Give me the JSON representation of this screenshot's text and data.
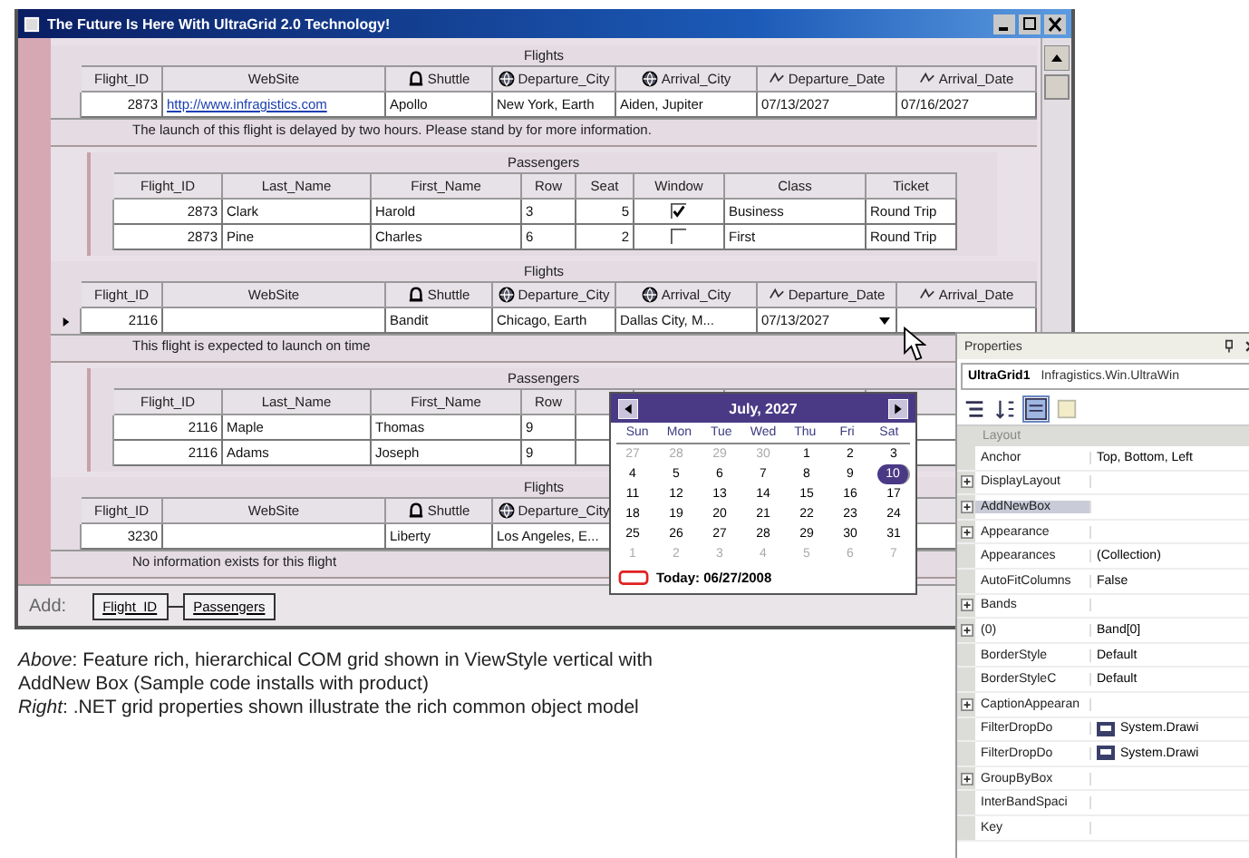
{
  "window": {
    "title": "The Future Is Here With UltraGrid 2.0 Technology!"
  },
  "flights": [
    {
      "caption": "Flights",
      "columns": [
        "Flight_ID",
        "WebSite",
        "Shuttle",
        "Departure_City",
        "Arrival_City",
        "Departure_Date",
        "Arrival_Date"
      ],
      "current": false,
      "cells": [
        "2873",
        "http://www.infragistics.com",
        "Apollo",
        "New York, Earth",
        "Aiden, Jupiter",
        "07/13/2027",
        "07/16/2027"
      ],
      "note": "The launch of this flight is delayed by two hours. Please stand by for more information.",
      "passengers": {
        "caption": "Passengers",
        "columns": [
          "Flight_ID",
          "Last_Name",
          "First_Name",
          "Row",
          "Seat",
          "Window",
          "Class",
          "Ticket"
        ],
        "rows": [
          {
            "cells": [
              "2873",
              "Clark",
              "Harold",
              "3",
              "5"
            ],
            "window_checked": true,
            "rest": [
              "Business",
              "Round Trip"
            ]
          },
          {
            "cells": [
              "2873",
              "Pine",
              "Charles",
              "6",
              "2"
            ],
            "window_checked": false,
            "rest": [
              "First",
              "Round Trip"
            ]
          }
        ]
      }
    },
    {
      "caption": "Flights",
      "columns": [
        "Flight_ID",
        "WebSite",
        "Shuttle",
        "Departure_City",
        "Arrival_City",
        "Departure_Date",
        "Arrival_Date"
      ],
      "current": true,
      "cells": [
        "2116",
        "",
        "Bandit",
        "Chicago, Earth",
        "Dallas City, M...",
        "07/13/2027"
      ],
      "note": "This flight is expected to launch on time",
      "passengers": {
        "caption": "Passengers",
        "columns": [
          "Flight_ID",
          "Last_Name",
          "First_Name",
          "Row"
        ],
        "rows": [
          {
            "cells": [
              "2116",
              "Maple",
              "Thomas",
              "9"
            ]
          },
          {
            "cells": [
              "2116",
              "Adams",
              "Joseph",
              "9"
            ]
          }
        ]
      }
    },
    {
      "caption": "Flights",
      "columns": [
        "Flight_ID",
        "WebSite",
        "Shuttle",
        "Departure_City"
      ],
      "current": false,
      "cells": [
        "3230",
        "",
        "Liberty",
        "Los Angeles, E..."
      ],
      "note": "No information exists for this flight"
    }
  ],
  "add_bar": {
    "label": "Add:",
    "buttons": [
      "Flight_ID",
      "Passengers"
    ]
  },
  "calendar": {
    "title": "July, 2027",
    "weekdays": [
      "Sun",
      "Mon",
      "Tue",
      "Wed",
      "Thu",
      "Fri",
      "Sat"
    ],
    "weeks": [
      [
        {
          "day": "27",
          "muted": true,
          "selected": false
        },
        {
          "day": "28",
          "muted": true,
          "selected": false
        },
        {
          "day": "29",
          "muted": true,
          "selected": false
        },
        {
          "day": "30",
          "muted": true,
          "selected": false
        },
        {
          "day": "1",
          "muted": false,
          "selected": false
        },
        {
          "day": "2",
          "muted": false,
          "selected": false
        },
        {
          "day": "3",
          "muted": false,
          "selected": false
        }
      ],
      [
        {
          "day": "4",
          "muted": false,
          "selected": false
        },
        {
          "day": "5",
          "muted": false,
          "selected": false
        },
        {
          "day": "6",
          "muted": false,
          "selected": false
        },
        {
          "day": "7",
          "muted": false,
          "selected": false
        },
        {
          "day": "8",
          "muted": false,
          "selected": false
        },
        {
          "day": "9",
          "muted": false,
          "selected": false
        },
        {
          "day": "10",
          "muted": false,
          "selected": true
        }
      ],
      [
        {
          "day": "11",
          "muted": false,
          "selected": false
        },
        {
          "day": "12",
          "muted": false,
          "selected": false
        },
        {
          "day": "13",
          "muted": false,
          "selected": false
        },
        {
          "day": "14",
          "muted": false,
          "selected": false
        },
        {
          "day": "15",
          "muted": false,
          "selected": false
        },
        {
          "day": "16",
          "muted": false,
          "selected": false
        },
        {
          "day": "17",
          "muted": false,
          "selected": false
        }
      ],
      [
        {
          "day": "18",
          "muted": false,
          "selected": false
        },
        {
          "day": "19",
          "muted": false,
          "selected": false
        },
        {
          "day": "20",
          "muted": false,
          "selected": false
        },
        {
          "day": "21",
          "muted": false,
          "selected": false
        },
        {
          "day": "22",
          "muted": false,
          "selected": false
        },
        {
          "day": "23",
          "muted": false,
          "selected": false
        },
        {
          "day": "24",
          "muted": false,
          "selected": false
        }
      ],
      [
        {
          "day": "25",
          "muted": false,
          "selected": false
        },
        {
          "day": "26",
          "muted": false,
          "selected": false
        },
        {
          "day": "27",
          "muted": false,
          "selected": false
        },
        {
          "day": "28",
          "muted": false,
          "selected": false
        },
        {
          "day": "29",
          "muted": false,
          "selected": false
        },
        {
          "day": "30",
          "muted": false,
          "selected": false
        },
        {
          "day": "31",
          "muted": false,
          "selected": false
        }
      ],
      [
        {
          "day": "1",
          "muted": true,
          "selected": false
        },
        {
          "day": "2",
          "muted": true,
          "selected": false
        },
        {
          "day": "3",
          "muted": true,
          "selected": false
        },
        {
          "day": "4",
          "muted": true,
          "selected": false
        },
        {
          "day": "5",
          "muted": true,
          "selected": false
        },
        {
          "day": "6",
          "muted": true,
          "selected": false
        },
        {
          "day": "7",
          "muted": true,
          "selected": false
        }
      ]
    ],
    "today": "Today: 06/27/2008"
  },
  "properties": {
    "title": "Properties",
    "object_name": "UltraGrid1",
    "object_type": "Infragistics.Win.UltraWin",
    "category": "Layout",
    "rows": [
      {
        "name": "Anchor",
        "value": "Top, Bottom, Left",
        "kind": "plain",
        "selected": false
      },
      {
        "name": "DisplayLayout",
        "kind": "expander",
        "selected": false
      },
      {
        "name": "AddNewBox",
        "kind": "expander",
        "selected": true
      },
      {
        "name": "Appearance",
        "kind": "expander",
        "selected": false
      },
      {
        "name": "Appearances",
        "value": "(Collection)",
        "kind": "plain",
        "selected": false
      },
      {
        "name": "AutoFitColumns",
        "value": "False",
        "kind": "plain",
        "selected": false
      },
      {
        "name": "Bands",
        "kind": "expander",
        "selected": false
      },
      {
        "name": "(0)",
        "value": "Band[0]",
        "kind": "expander",
        "selected": false
      },
      {
        "name": "BorderStyle",
        "value": "Default",
        "kind": "plain",
        "selected": false
      },
      {
        "name": "BorderStyleC",
        "value": "Default",
        "kind": "plain",
        "selected": false
      },
      {
        "name": "CaptionAppearan",
        "kind": "expander",
        "selected": false
      },
      {
        "name": "FilterDropDo",
        "value": "System.Drawi",
        "kind": "swatch",
        "selected": false
      },
      {
        "name": "FilterDropDo",
        "value": "System.Drawi",
        "kind": "swatch",
        "selected": false
      },
      {
        "name": "GroupByBox",
        "kind": "expander",
        "selected": false
      },
      {
        "name": "InterBandSpaci",
        "kind": "plain",
        "selected": false
      },
      {
        "name": "Key",
        "kind": "plain",
        "selected": false
      }
    ]
  },
  "caption_lines": [
    "*Above*: Feature rich, hierarchical COM grid shown in ViewStyle vertical with",
    "AddNew Box (Sample code installs with product)",
    "*Right*: .NET grid properties shown illustrate the rich common object model"
  ]
}
